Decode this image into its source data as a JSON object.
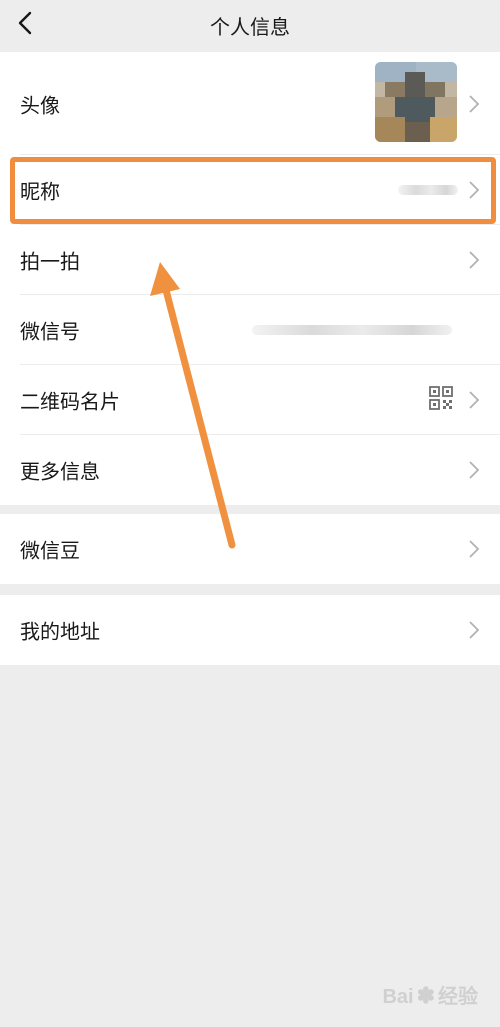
{
  "header": {
    "title": "个人信息"
  },
  "groups": [
    {
      "items": [
        {
          "label": "头像"
        },
        {
          "label": "昵称"
        },
        {
          "label": "拍一拍"
        },
        {
          "label": "微信号"
        },
        {
          "label": "二维码名片"
        },
        {
          "label": "更多信息"
        }
      ]
    },
    {
      "items": [
        {
          "label": "微信豆"
        }
      ]
    },
    {
      "items": [
        {
          "label": "我的地址"
        }
      ]
    }
  ],
  "watermark": {
    "brand": "Bai",
    "brand_suffix": "经验"
  },
  "colors": {
    "background": "#ededed",
    "highlight": "#f08d3f",
    "row_bg": "#ffffff"
  }
}
